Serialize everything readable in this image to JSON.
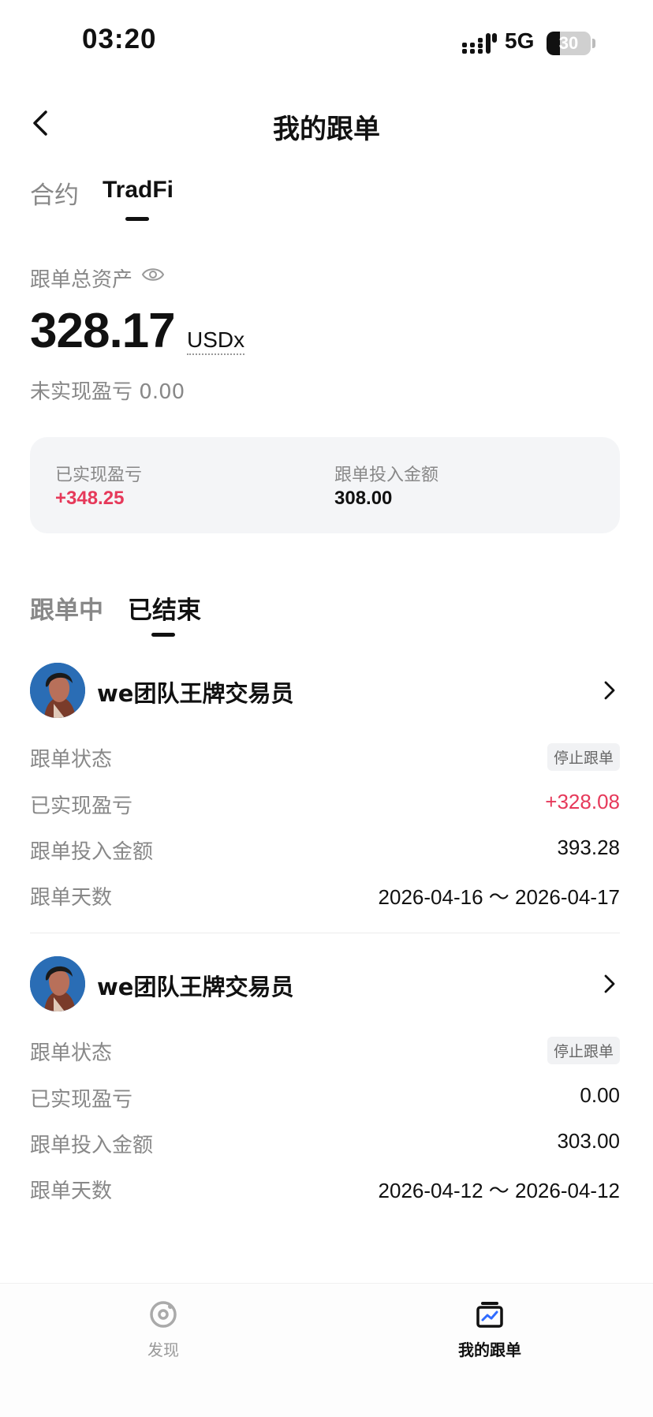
{
  "status_bar": {
    "time": "03:20",
    "network": "5G",
    "battery": "30",
    "battery_level": 0.3
  },
  "header": {
    "title": "我的跟单"
  },
  "top_tabs": [
    {
      "label": "合约"
    },
    {
      "label": "TradFi"
    }
  ],
  "summary": {
    "assets_label": "跟单总资产",
    "total_value": "328.17",
    "unit": "USDx",
    "unrealized_label": "未实现盈亏",
    "unrealized_value": "0.00"
  },
  "stats_card": {
    "realized_label": "已实现盈亏",
    "realized_value": "+348.25",
    "invest_label": "跟单投入金额",
    "invest_value": "308.00"
  },
  "list_tabs": [
    {
      "label": "跟单中"
    },
    {
      "label": "已结束"
    }
  ],
  "records": [
    {
      "trader_name": "we团队王牌交易员",
      "status_label": "跟单状态",
      "status_value": "停止跟单",
      "realized_label": "已实现盈亏",
      "realized_value": "+328.08",
      "invest_label": "跟单投入金额",
      "invest_value": "393.28",
      "days_label": "跟单天数",
      "days_value": "2026-04-16 ～ 2026-04-17"
    },
    {
      "trader_name": "we团队王牌交易员",
      "status_label": "跟单状态",
      "status_value": "停止跟单",
      "realized_label": "已实现盈亏",
      "realized_value": "0.00",
      "invest_label": "跟单投入金额",
      "invest_value": "303.00",
      "days_label": "跟单天数",
      "days_value": "2026-04-12 ～ 2026-04-12"
    }
  ],
  "bottom_nav": [
    {
      "label": "发现",
      "icon": "discover-icon"
    },
    {
      "label": "我的跟单",
      "icon": "my-copy-trading-icon"
    }
  ],
  "colors": {
    "positive": "#e6395a",
    "muted": "#888888",
    "text": "#111111"
  }
}
